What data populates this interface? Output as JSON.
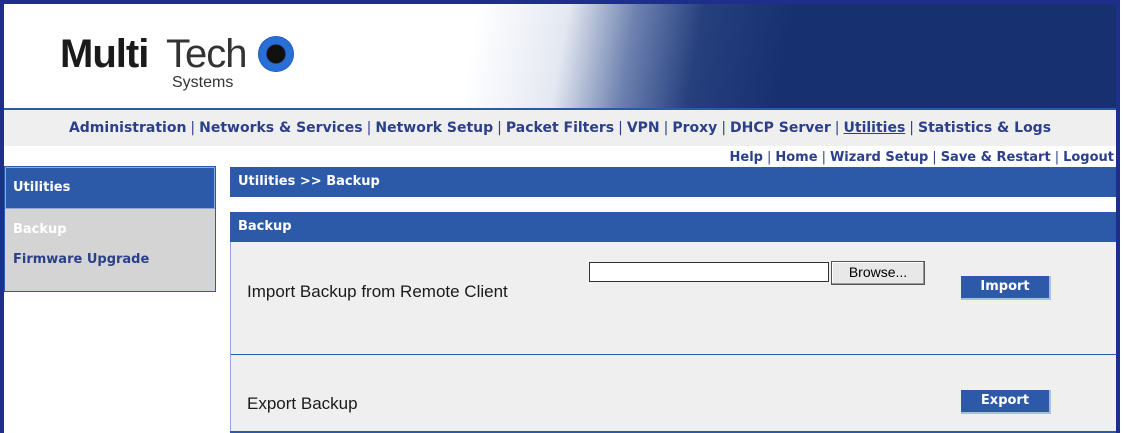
{
  "brand": {
    "logo_bold": "Multi",
    "logo_light": "Tech",
    "logo_sub": "Systems"
  },
  "nav": {
    "items": [
      {
        "label": "Administration"
      },
      {
        "label": "Networks & Services"
      },
      {
        "label": "Network Setup"
      },
      {
        "label": "Packet Filters"
      },
      {
        "label": "VPN"
      },
      {
        "label": "Proxy"
      },
      {
        "label": "DHCP Server"
      },
      {
        "label": "Utilities",
        "active": true
      },
      {
        "label": "Statistics & Logs"
      }
    ]
  },
  "toplinks": {
    "help": "Help",
    "home": "Home",
    "wizard": "Wizard Setup",
    "save_restart": "Save & Restart",
    "logout": "Logout"
  },
  "sidebar": {
    "title": "Utilities",
    "items": [
      {
        "label": "Backup",
        "active": true
      },
      {
        "label": "Firmware Upgrade"
      }
    ]
  },
  "breadcrumb": "Utilities >> Backup",
  "section": {
    "title": "Backup",
    "import_label": "Import Backup from Remote Client",
    "file_value": "",
    "browse_label": "Browse...",
    "import_button": "Import",
    "export_label": "Export Backup",
    "export_button": "Export"
  },
  "colors": {
    "frame": "#1e2e8c",
    "header_blue": "#2d5aa8",
    "link_blue": "#2b3f8a",
    "panel_bg": "#efefef",
    "sidebar_bg": "#d4d4d4"
  }
}
